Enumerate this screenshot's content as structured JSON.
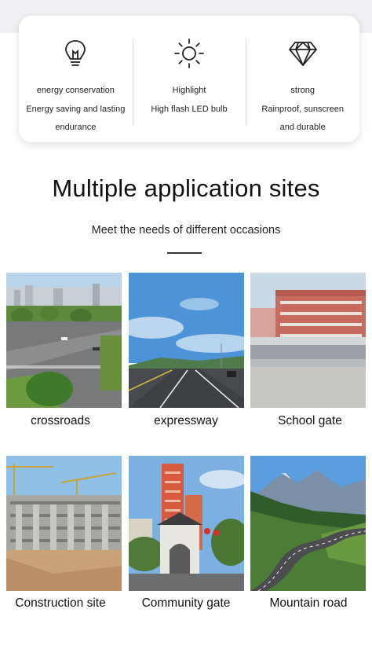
{
  "features": [
    {
      "icon": "bulb-icon",
      "title": "energy conservation",
      "desc_line1": "Energy saving and lasting",
      "desc_line2": "endurance"
    },
    {
      "icon": "sun-icon",
      "title": "Highlight",
      "desc_line1": "High flash LED bulb",
      "desc_line2": ""
    },
    {
      "icon": "diamond-icon",
      "title": "strong",
      "desc_line1": "Rainproof, sunscreen",
      "desc_line2": "and durable"
    }
  ],
  "section": {
    "title": "Multiple application sites",
    "subtitle": "Meet the needs of different occasions"
  },
  "sites": [
    {
      "label": "crossroads"
    },
    {
      "label": "expressway"
    },
    {
      "label": "School gate"
    },
    {
      "label": "Construction site"
    },
    {
      "label": "Community gate"
    },
    {
      "label": "Mountain road"
    }
  ]
}
